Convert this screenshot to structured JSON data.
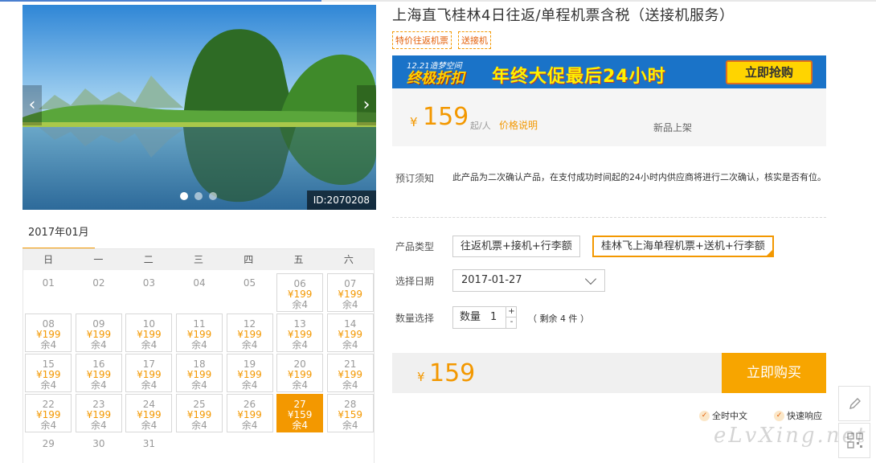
{
  "gallery": {
    "prev_symbol": "‹",
    "next_symbol": "›",
    "id_badge": "ID:2070208",
    "dot_count": 3,
    "active_dot": 1
  },
  "calendar": {
    "month": "2017年01月",
    "weekdays": [
      "日",
      "一",
      "二",
      "三",
      "四",
      "五",
      "六"
    ],
    "days": [
      {
        "day": "01",
        "available": false
      },
      {
        "day": "02",
        "available": false
      },
      {
        "day": "03",
        "available": false
      },
      {
        "day": "04",
        "available": false
      },
      {
        "day": "05",
        "available": false
      },
      {
        "day": "06",
        "available": true,
        "price": "¥199",
        "remain": "余4"
      },
      {
        "day": "07",
        "available": true,
        "price": "¥199",
        "remain": "余4"
      },
      {
        "day": "08",
        "available": true,
        "price": "¥199",
        "remain": "余4"
      },
      {
        "day": "09",
        "available": true,
        "price": "¥199",
        "remain": "余4"
      },
      {
        "day": "10",
        "available": true,
        "price": "¥199",
        "remain": "余4"
      },
      {
        "day": "11",
        "available": true,
        "price": "¥199",
        "remain": "余4"
      },
      {
        "day": "12",
        "available": true,
        "price": "¥199",
        "remain": "余4"
      },
      {
        "day": "13",
        "available": true,
        "price": "¥199",
        "remain": "余4"
      },
      {
        "day": "14",
        "available": true,
        "price": "¥199",
        "remain": "余4"
      },
      {
        "day": "15",
        "available": true,
        "price": "¥199",
        "remain": "余4"
      },
      {
        "day": "16",
        "available": true,
        "price": "¥199",
        "remain": "余4"
      },
      {
        "day": "17",
        "available": true,
        "price": "¥199",
        "remain": "余4"
      },
      {
        "day": "18",
        "available": true,
        "price": "¥199",
        "remain": "余4"
      },
      {
        "day": "19",
        "available": true,
        "price": "¥199",
        "remain": "余4"
      },
      {
        "day": "20",
        "available": true,
        "price": "¥199",
        "remain": "余4"
      },
      {
        "day": "21",
        "available": true,
        "price": "¥199",
        "remain": "余4"
      },
      {
        "day": "22",
        "available": true,
        "price": "¥199",
        "remain": "余4"
      },
      {
        "day": "23",
        "available": true,
        "price": "¥199",
        "remain": "余4"
      },
      {
        "day": "24",
        "available": true,
        "price": "¥199",
        "remain": "余4"
      },
      {
        "day": "25",
        "available": true,
        "price": "¥199",
        "remain": "余4"
      },
      {
        "day": "26",
        "available": true,
        "price": "¥199",
        "remain": "余4"
      },
      {
        "day": "27",
        "available": true,
        "price": "¥159",
        "remain": "余4",
        "selected": true
      },
      {
        "day": "28",
        "available": true,
        "price": "¥159",
        "remain": "余4"
      },
      {
        "day": "29",
        "available": false
      },
      {
        "day": "30",
        "available": false
      },
      {
        "day": "31",
        "available": false
      }
    ],
    "first_weekday": 0
  },
  "product": {
    "title": "上海直飞桂林4日往返/单程机票含税（送接机服务）",
    "tags": [
      "特价往返机票",
      "送接机"
    ]
  },
  "banner": {
    "small_text": "12.21造梦空间",
    "main_left": "终极折扣",
    "main_mid": "年终大促最后24小时",
    "cta": "立即抢购"
  },
  "price": {
    "currency": "¥",
    "amount": "159",
    "unit": "起/人",
    "explain": "价格说明",
    "new_label": "新品上架"
  },
  "booking": {
    "notice_label": "预订须知",
    "notice_text": "此产品为二次确认产品，在支付成功时间起的24小时内供应商将进行二次确认，核实是否有位。",
    "type_label": "产品类型",
    "types": [
      "往返机票+接机+行李额",
      "桂林飞上海单程机票+送机+行李额"
    ],
    "active_type": 1,
    "date_label": "选择日期",
    "date_value": "2017-01-27",
    "qty_label": "数量选择",
    "qty_inner_label": "数量",
    "qty_value": "1",
    "plus": "+",
    "minus": "-",
    "remain": "（ 剩余 4 件 ）"
  },
  "checkout": {
    "currency": "¥",
    "amount": "159",
    "buy_button": "立即购买"
  },
  "features": [
    {
      "icon": "check-icon",
      "label": "全时中文"
    },
    {
      "icon": "check-icon",
      "label": "快速响应"
    }
  ],
  "watermark": "eLvXing.net",
  "colors": {
    "accent": "#f39800",
    "banner_bg": "#1a73c8",
    "buy_button": "#f7a500"
  }
}
